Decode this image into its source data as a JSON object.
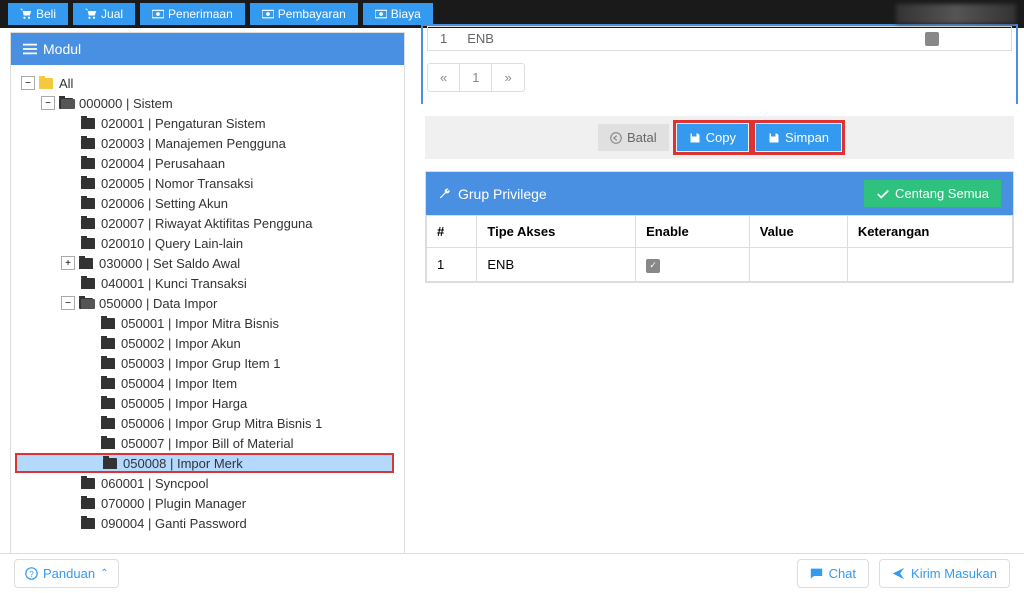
{
  "topbar": {
    "beli": "Beli",
    "jual": "Jual",
    "penerimaan": "Penerimaan",
    "pembayaran": "Pembayaran",
    "biaya": "Biaya"
  },
  "left": {
    "title": "Modul",
    "tree": {
      "all": "All",
      "sistem": "000000 | Sistem",
      "n020001": "020001 | Pengaturan Sistem",
      "n020003": "020003 | Manajemen Pengguna",
      "n020004": "020004 | Perusahaan",
      "n020005": "020005 | Nomor Transaksi",
      "n020006": "020006 | Setting Akun",
      "n020007": "020007 | Riwayat Aktifitas Pengguna",
      "n020010": "020010 | Query Lain-lain",
      "n030000": "030000 | Set Saldo Awal",
      "n040001": "040001 | Kunci Transaksi",
      "n050000": "050000 | Data Impor",
      "n050001": "050001 | Impor Mitra Bisnis",
      "n050002": "050002 | Impor Akun",
      "n050003": "050003 | Impor Grup Item 1",
      "n050004": "050004 | Impor Item",
      "n050005": "050005 | Impor Harga",
      "n050006": "050006 | Impor Grup Mitra Bisnis 1",
      "n050007": "050007 | Impor Bill of Material",
      "n050008": "050008 | Impor Merk",
      "n060001": "060001 | Syncpool",
      "n070000": "070000 | Plugin Manager",
      "n090004": "090004 | Ganti Password"
    }
  },
  "right": {
    "prev": {
      "num": "1",
      "text": "ENB"
    },
    "pagination": {
      "prev": "«",
      "one": "1",
      "next": "»"
    },
    "actions": {
      "batal": "Batal",
      "copy": "Copy",
      "simpan": "Simpan"
    },
    "priv": {
      "title": "Grup Privilege",
      "centang": "Centang Semua",
      "th_num": "#",
      "th_tipe": "Tipe Akses",
      "th_enable": "Enable",
      "th_value": "Value",
      "th_ket": "Keterangan",
      "r1_num": "1",
      "r1_tipe": "ENB"
    }
  },
  "bottom": {
    "panduan": "Panduan",
    "chat": "Chat",
    "masukan": "Kirim Masukan"
  }
}
